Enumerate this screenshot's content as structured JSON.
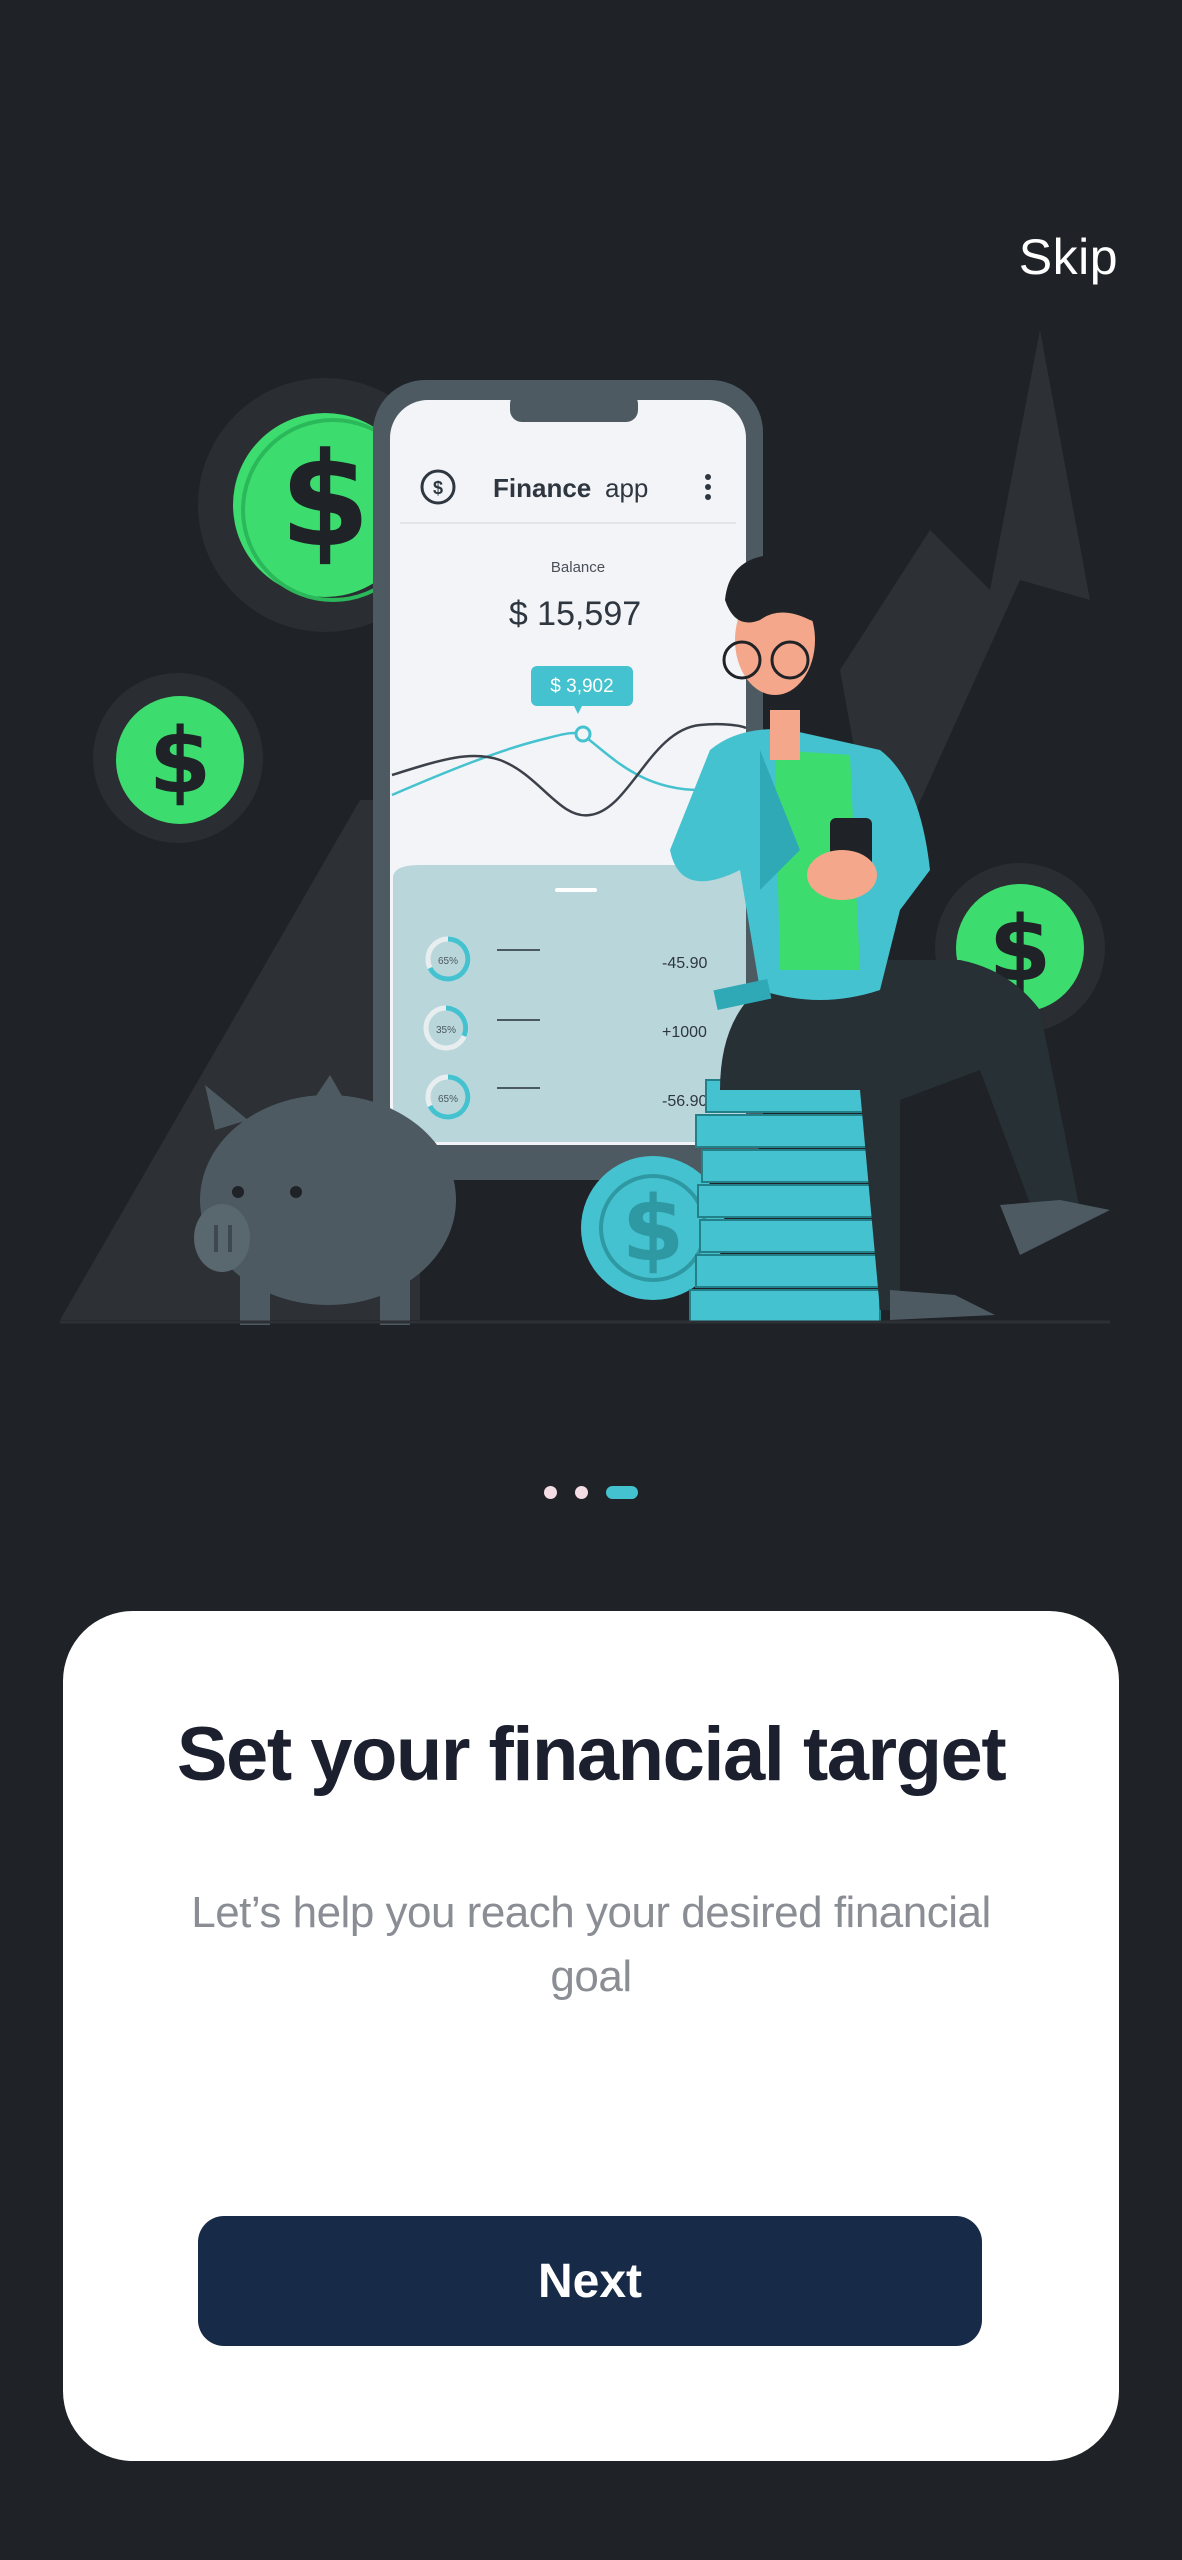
{
  "header": {
    "skip_label": "Skip"
  },
  "illustration": {
    "phone": {
      "app_title_bold": "Finance",
      "app_title_light": "app",
      "balance_label": "Balance",
      "balance_value": "$ 15,597",
      "tooltip_value": "$ 3,902",
      "rows": [
        {
          "percent": "65%",
          "amount": "-45.90"
        },
        {
          "percent": "35%",
          "amount": "+1000"
        },
        {
          "percent": "65%",
          "amount": "-56.90"
        }
      ]
    }
  },
  "pagination": {
    "total": 3,
    "active": 3
  },
  "card": {
    "title": "Set your financial target",
    "subtitle": "Let’s help you reach your desired financial goal",
    "next_label": "Next"
  },
  "colors": {
    "background": "#1f2226",
    "accent": "#45c2cf",
    "green": "#3ddc6e",
    "button": "#172a47"
  }
}
